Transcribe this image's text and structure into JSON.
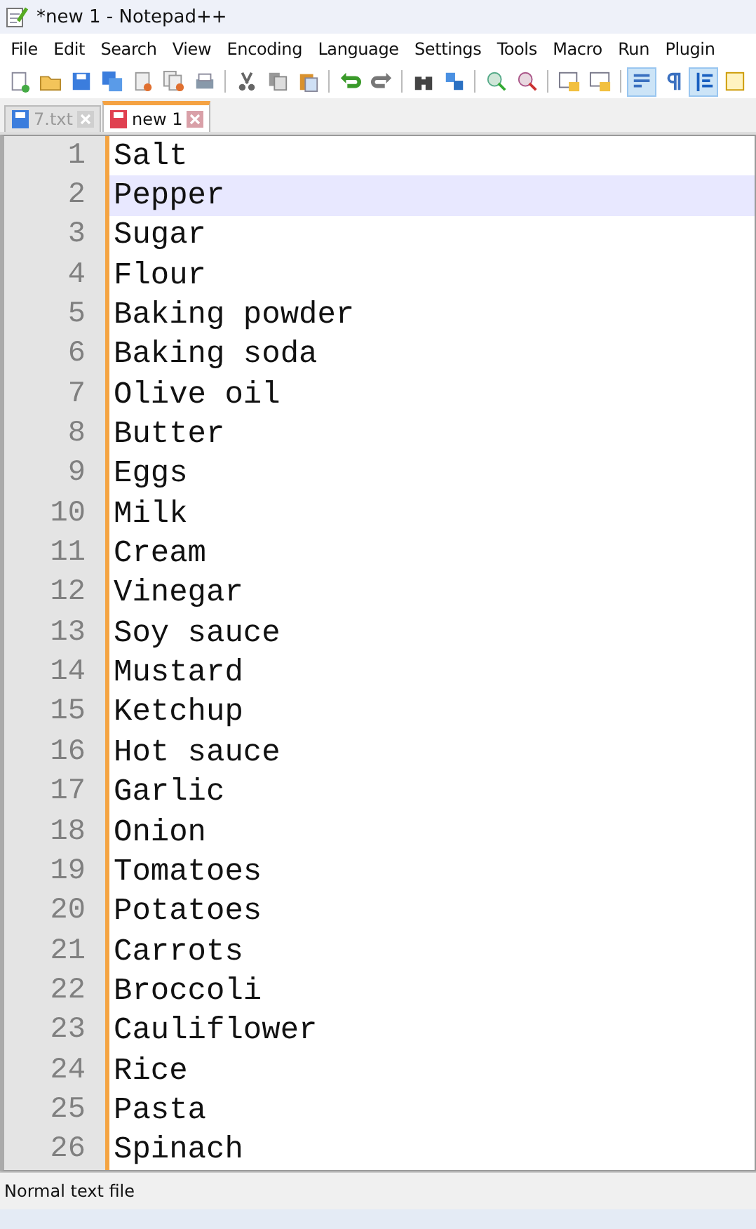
{
  "window": {
    "title": "*new 1 - Notepad++"
  },
  "menu": [
    "File",
    "Edit",
    "Search",
    "View",
    "Encoding",
    "Language",
    "Settings",
    "Tools",
    "Macro",
    "Run",
    "Plugin"
  ],
  "toolbar": [
    {
      "pressed": false
    },
    {
      "pressed": false
    },
    {
      "pressed": false
    },
    {
      "pressed": false
    },
    {
      "pressed": false
    },
    {
      "pressed": false
    },
    {
      "pressed": false
    },
    {
      "pressed": false
    },
    {
      "pressed": false
    },
    {
      "pressed": false
    },
    {
      "pressed": false
    },
    {
      "pressed": false
    },
    {
      "pressed": false
    },
    {
      "pressed": false
    },
    {
      "pressed": false
    },
    {
      "pressed": false
    },
    {
      "pressed": false
    },
    {
      "pressed": false
    },
    {
      "pressed": true
    },
    {
      "pressed": false
    },
    {
      "pressed": true
    },
    {
      "pressed": false
    }
  ],
  "tabs": [
    {
      "label": "7.txt",
      "selected": false,
      "modified": false
    },
    {
      "label": "new 1",
      "selected": true,
      "modified": true
    }
  ],
  "lines": [
    {
      "number": "1",
      "text": "Salt",
      "current": false
    },
    {
      "number": "2",
      "text": "Pepper",
      "current": true
    },
    {
      "number": "3",
      "text": "Sugar",
      "current": false
    },
    {
      "number": "4",
      "text": "Flour",
      "current": false
    },
    {
      "number": "5",
      "text": "Baking powder",
      "current": false
    },
    {
      "number": "6",
      "text": "Baking soda",
      "current": false
    },
    {
      "number": "7",
      "text": "Olive oil",
      "current": false
    },
    {
      "number": "8",
      "text": "Butter",
      "current": false
    },
    {
      "number": "9",
      "text": "Eggs",
      "current": false
    },
    {
      "number": "10",
      "text": "Milk",
      "current": false
    },
    {
      "number": "11",
      "text": "Cream",
      "current": false
    },
    {
      "number": "12",
      "text": "Vinegar",
      "current": false
    },
    {
      "number": "13",
      "text": "Soy sauce",
      "current": false
    },
    {
      "number": "14",
      "text": "Mustard",
      "current": false
    },
    {
      "number": "15",
      "text": "Ketchup",
      "current": false
    },
    {
      "number": "16",
      "text": "Hot sauce",
      "current": false
    },
    {
      "number": "17",
      "text": "Garlic",
      "current": false
    },
    {
      "number": "18",
      "text": "Onion",
      "current": false
    },
    {
      "number": "19",
      "text": "Tomatoes",
      "current": false
    },
    {
      "number": "20",
      "text": "Potatoes",
      "current": false
    },
    {
      "number": "21",
      "text": "Carrots",
      "current": false
    },
    {
      "number": "22",
      "text": "Broccoli",
      "current": false
    },
    {
      "number": "23",
      "text": "Cauliflower",
      "current": false
    },
    {
      "number": "24",
      "text": "Rice",
      "current": false
    },
    {
      "number": "25",
      "text": "Pasta",
      "current": false
    },
    {
      "number": "26",
      "text": "Spinach",
      "current": false
    }
  ],
  "status_bar": {
    "file_type": "Normal text file"
  }
}
